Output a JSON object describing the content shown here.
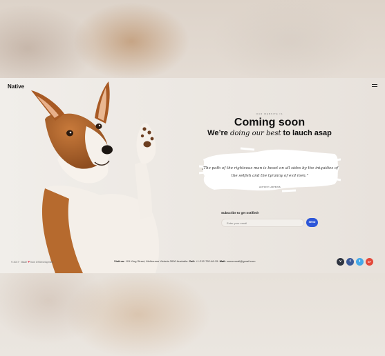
{
  "brand": {
    "logo": "Native"
  },
  "hero": {
    "eyebrow": "OUR WEBSITE IS",
    "headline": "Coming soon",
    "subline_pre": "We’re ",
    "subline_em": "doing our best",
    "subline_post": " to lauch asap"
  },
  "quote": {
    "text": "„The path of the righteous man is beset on all sides by the iniquities of the selfish and the tyranny of evil men.”",
    "author": "ANTONY HOPKINS"
  },
  "subscribe": {
    "label": "Subscribe to get notified!",
    "placeholder": "Enter your email",
    "button": "SEND"
  },
  "footer": {
    "copy_pre": "© 2017 · Made ",
    "heart": "♥",
    "copy_post": " from DTDevelopment",
    "visit_label": "Visit us:",
    "visit_value": "101 King Street, Melbourne Victoria 3000 Australia.",
    "call_label": "Call:",
    "call_value": "+1-212-752-46-15.",
    "mail_label": "Mail:",
    "mail_value": "someemail@gmail.com"
  },
  "socials": [
    {
      "name": "vimeo",
      "glyph": "v",
      "color": "#2f3440"
    },
    {
      "name": "facebook",
      "glyph": "f",
      "color": "#3b5998"
    },
    {
      "name": "twitter",
      "glyph": "t",
      "color": "#45a8e8"
    },
    {
      "name": "google-plus",
      "glyph": "G+",
      "color": "#e3483a"
    }
  ]
}
